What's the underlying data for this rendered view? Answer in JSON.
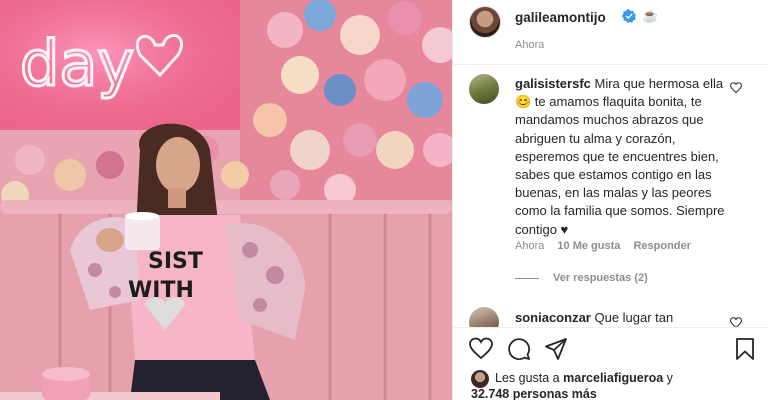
{
  "photo": {
    "neon_text": "day",
    "shirt_text_1": "SIST",
    "shirt_text_2": "WITH"
  },
  "post": {
    "username": "galileamontijo",
    "coffee_emoji": "☕",
    "time": "Ahora"
  },
  "comment": {
    "username": "galisistersfc",
    "text": "Mira que hermosa ella 😊 te amamos flaquita bonita, te mandamos muchos abrazos que abriguen tu alma y corazón, esperemos que te encuentres bien, sabes que estamos contigo en las buenas, en las malas y las peores como la familia que somos. Siempre contigo ♥",
    "time": "Ahora",
    "likes": "10 Me gusta",
    "reply": "Responder",
    "view_replies": "Ver respuestas (2)"
  },
  "comment2": {
    "username": "soniaconzar",
    "text": "Que lugar tan"
  },
  "likes": {
    "prefix": "Les gusta a",
    "user": "marceliafigueroa",
    "and": "y",
    "others": "32.748 personas más"
  },
  "icons": {
    "like": "heart-icon",
    "comment": "comment-icon",
    "share": "share-icon",
    "save": "bookmark-icon",
    "verified": "verified-badge-icon"
  },
  "colors": {
    "verified_blue": "#3897f0",
    "text": "#262626",
    "muted": "#8e8e8e",
    "neon_pink": "#ff4f8a",
    "heart_red": "#c4202c"
  }
}
